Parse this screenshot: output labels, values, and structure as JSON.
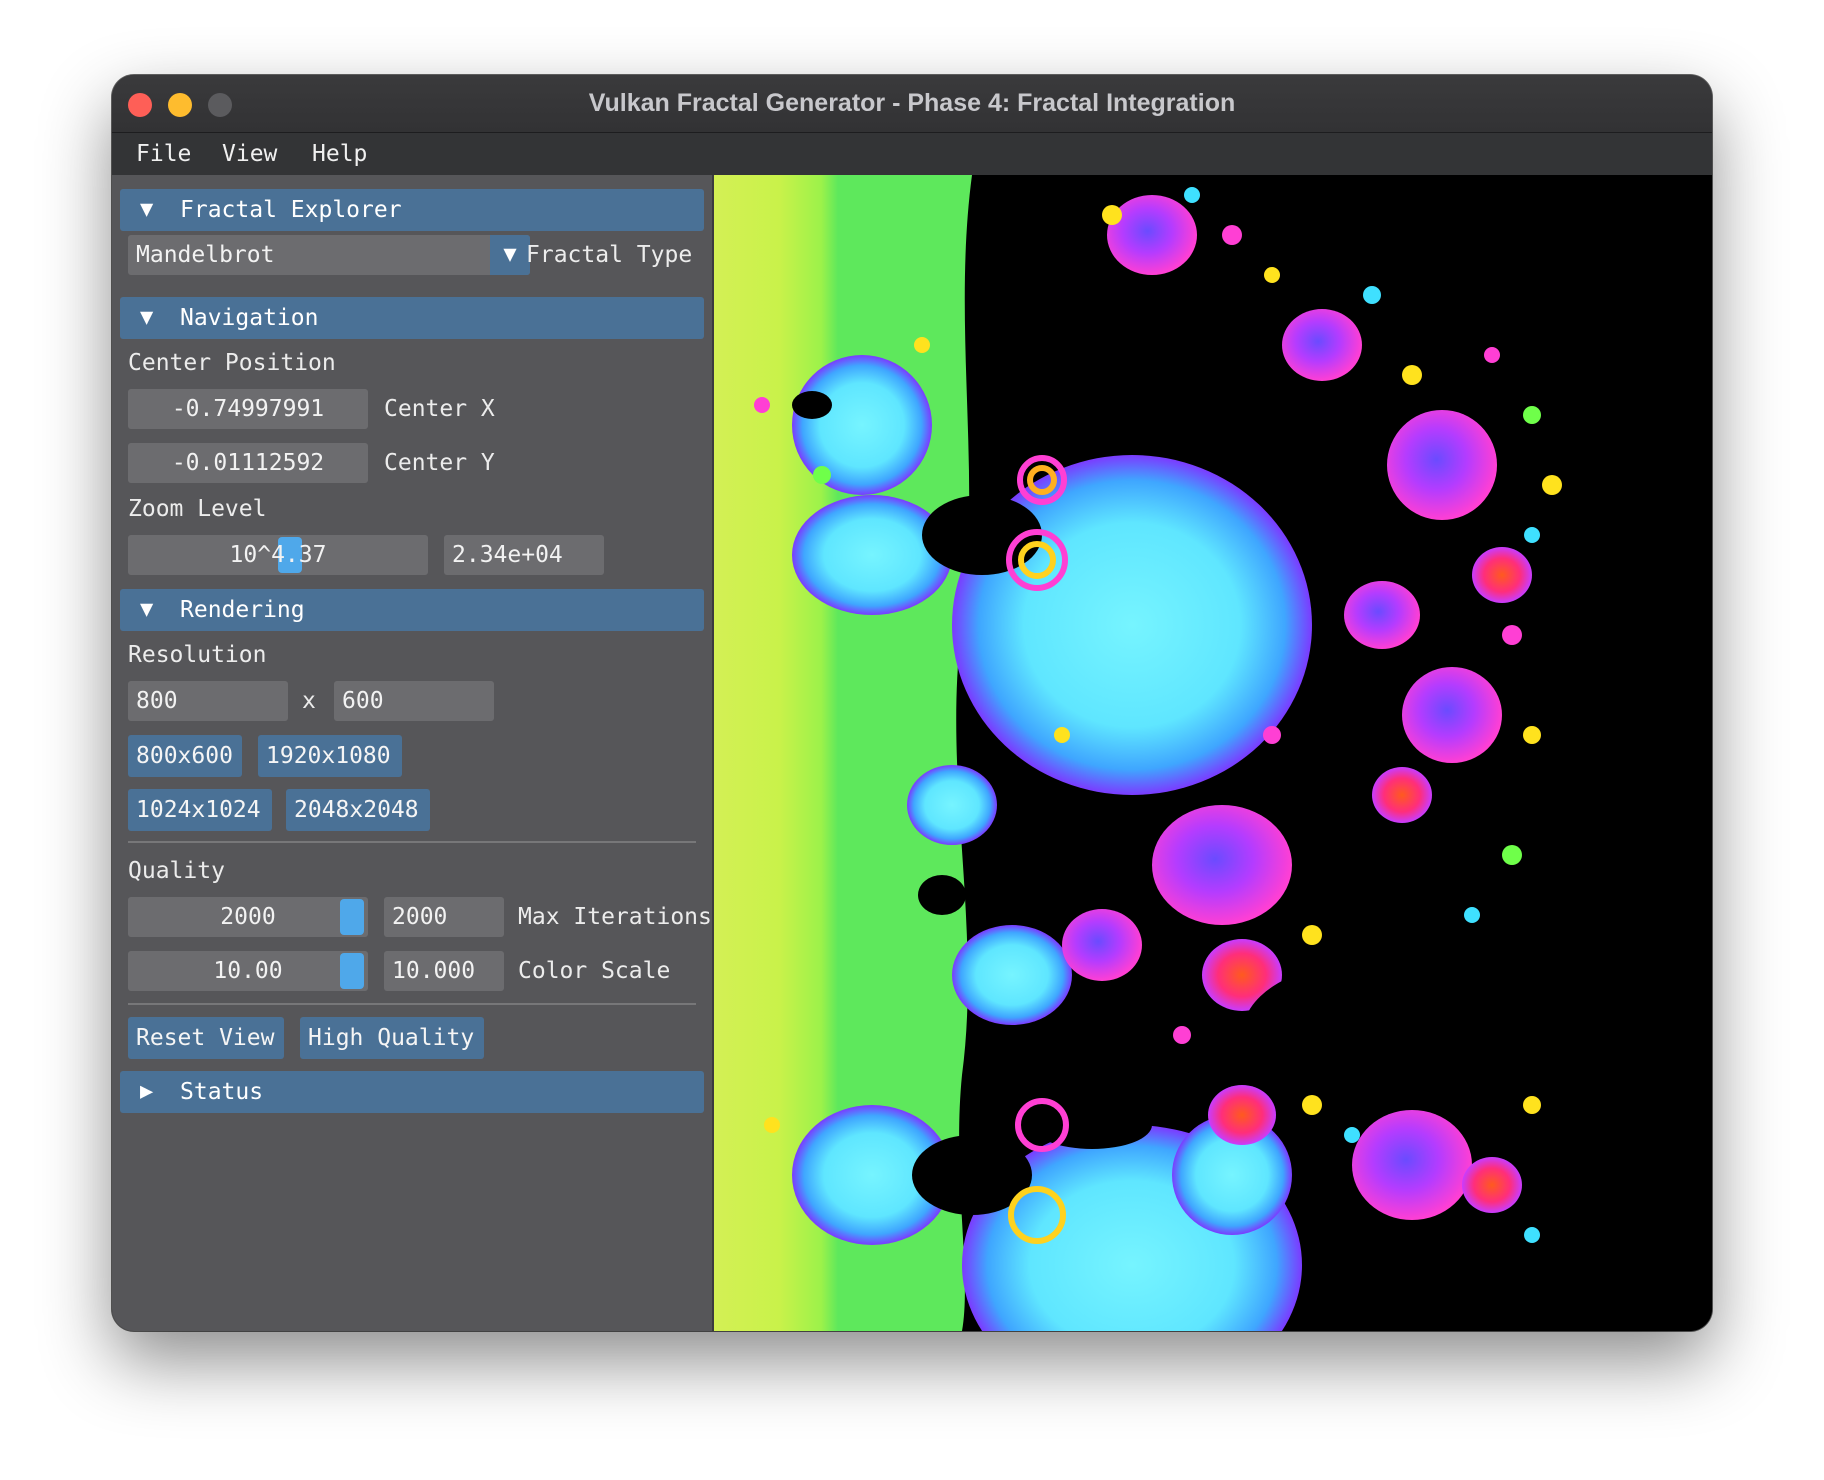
{
  "window": {
    "title": "Vulkan Fractal Generator - Phase 4: Fractal Integration"
  },
  "menubar": {
    "items": [
      "File",
      "View",
      "Help"
    ]
  },
  "panel": {
    "fractal_explorer": {
      "header": "Fractal Explorer",
      "fractal_type_value": "Mandelbrot",
      "fractal_type_label": "Fractal Type"
    },
    "navigation": {
      "header": "Navigation",
      "center_position_label": "Center Position",
      "center_x_value": "-0.74997991",
      "center_x_label": "Center X",
      "center_y_value": "-0.01112592",
      "center_y_label": "Center Y",
      "zoom_level_label": "Zoom Level",
      "zoom_slider_text": "10^4.37",
      "zoom_value": "2.34e+04"
    },
    "rendering": {
      "header": "Rendering",
      "resolution_label": "Resolution",
      "width_value": "800",
      "x_separator": "x",
      "height_value": "600",
      "presets": [
        "800x600",
        "1920x1080",
        "1024x1024",
        "2048x2048"
      ],
      "quality_label": "Quality",
      "max_iterations_slider": "2000",
      "max_iterations_input": "2000",
      "max_iterations_label": "Max Iterations",
      "color_scale_slider": "10.00",
      "color_scale_input": "10.000",
      "color_scale_label": "Color Scale",
      "reset_view_button": "Reset View",
      "high_quality_button": "High Quality"
    },
    "status": {
      "header": "Status"
    }
  },
  "icons": {
    "expanded_arrow": "▼",
    "collapsed_arrow": "▶",
    "dropdown_arrow": "▼"
  },
  "colors": {
    "accent": "#4a7196",
    "slider_grab": "#4fa8ea",
    "panel_bg": "#565659",
    "field_bg": "#6c6c6f"
  }
}
